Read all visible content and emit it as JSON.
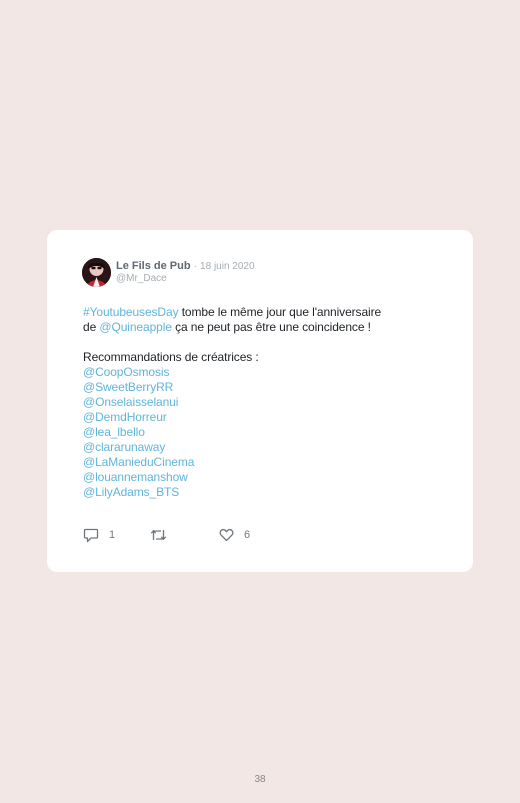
{
  "tweet": {
    "author_name": "Le Fils de Pub",
    "separator": "·",
    "date": "18 juin 2020",
    "handle": "@Mr_Dace",
    "line1_hashtag": "#YoutubeusesDay",
    "line1_text": " tombe le même jour que l'anniversaire",
    "line2_prefix": "de ",
    "line2_mention": "@Quineapple",
    "line2_text": " ça ne peut pas être une coincidence !",
    "recommendations_heading": "Recommandations de créatrices :",
    "mentions": [
      "@CoopOsmosis",
      "@SweetBerryRR",
      "@Onselaisselanui",
      "@DemdHorreur",
      "@lea_lbello",
      "@clararunaway",
      "@LaManieduCinema",
      "@louannemanshow",
      "@LilyAdams_BTS"
    ]
  },
  "actions": {
    "reply_count": "1",
    "retweet_count": "",
    "like_count": "6"
  },
  "icons": {
    "reply": "reply-icon",
    "retweet": "retweet-icon",
    "like": "heart-icon"
  },
  "colors": {
    "background": "#f2e7e4",
    "card": "#ffffff",
    "link": "#5fb5dc",
    "text": "#1e2226",
    "muted": "#a4adb3"
  },
  "page": {
    "number": "38"
  }
}
